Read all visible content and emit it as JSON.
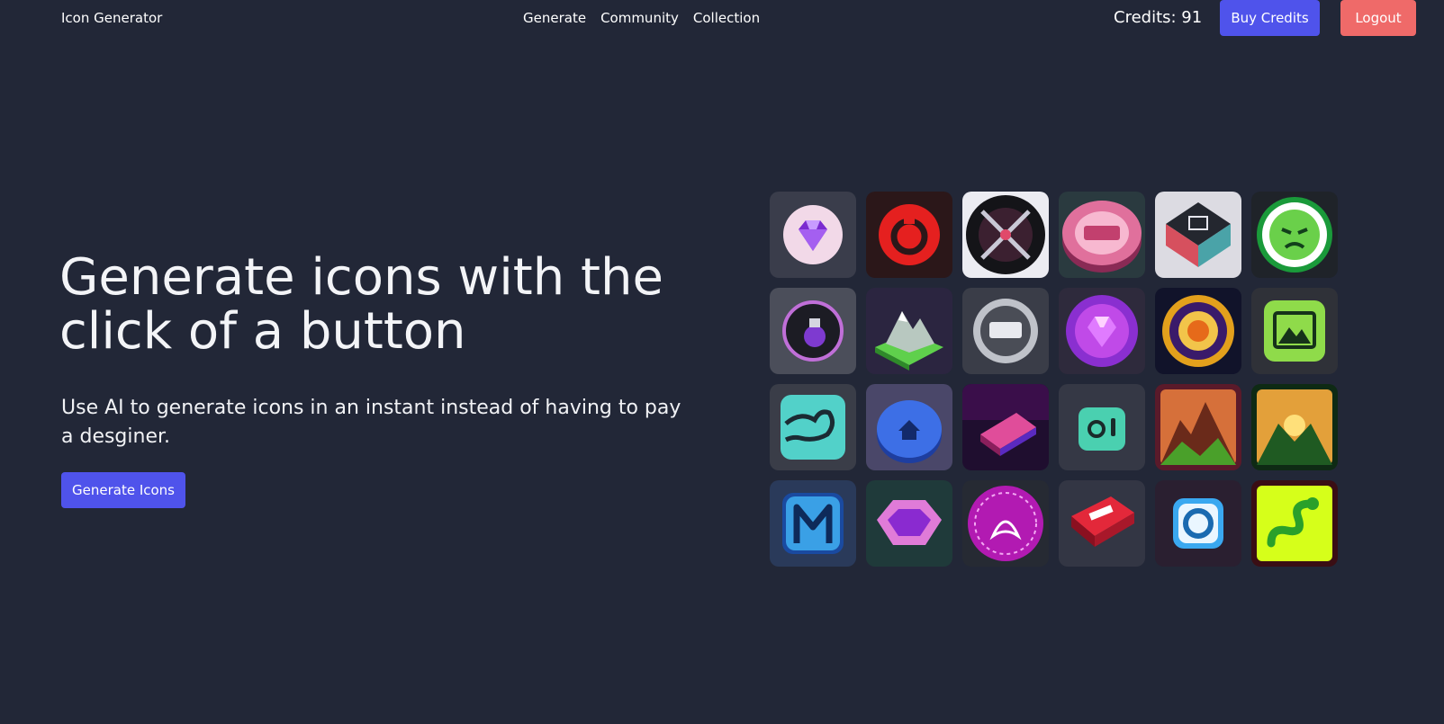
{
  "nav": {
    "brand": "Icon Generator",
    "links": [
      "Generate",
      "Community",
      "Collection"
    ],
    "credits": "Credits: 91",
    "buy_label": "Buy Credits",
    "logout_label": "Logout"
  },
  "hero": {
    "title": "Generate icons with the click of a button",
    "subtitle": "Use AI to generate icons in an instant instead of having to pay a desginer.",
    "cta_label": "Generate Icons"
  },
  "colors": {
    "background": "#222737",
    "accent": "#4f53eb",
    "logout": "#ef6a69"
  },
  "gallery": {
    "icons": [
      "purple-gem-icon",
      "red-power-ring-icon",
      "crossed-swords-icon",
      "pink-badge-icon",
      "dark-cube-icon",
      "green-alien-face-icon",
      "potion-bottle-icon",
      "mountain-island-icon",
      "silver-siz-coin-icon",
      "purple-crystal-orb-icon",
      "golden-ring-icon",
      "green-landscape-photo-icon",
      "flexed-arm-icon",
      "blue-home-button-icon",
      "pink-block-icon",
      "teal-toggle-icon",
      "mountain-sunset-icon",
      "valley-sunrise-icon",
      "letter-m-icon",
      "pink-octagon-gem-icon",
      "magenta-flower-icon",
      "red-jacake-badge-icon",
      "blue-camera-lens-icon",
      "green-snake-icon"
    ]
  }
}
